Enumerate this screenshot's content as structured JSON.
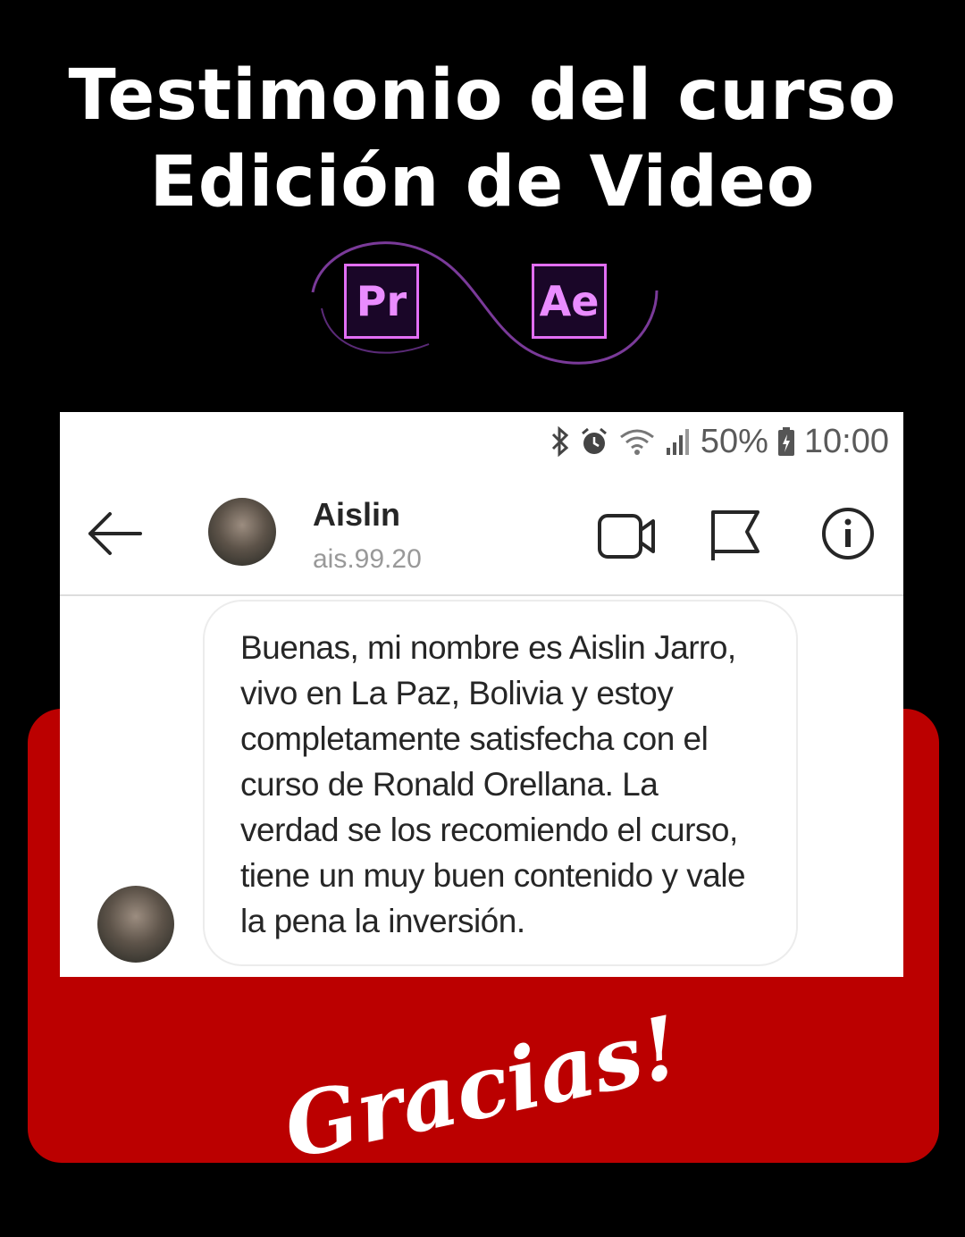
{
  "heading": {
    "line1": "Testimonio del curso",
    "line2": "Edición de Video"
  },
  "logos": {
    "premiere": "Pr",
    "after_effects": "Ae",
    "accent_color": "#e26ef5"
  },
  "status_bar": {
    "icons": [
      "bluetooth-icon",
      "alarm-icon",
      "wifi-icon",
      "signal-icon",
      "battery-icon"
    ],
    "battery_percent": "50%",
    "time": "10:00"
  },
  "chat_header": {
    "username": "Aislin",
    "handle": "ais.99.20",
    "icons": [
      "back-arrow-icon",
      "video-call-icon",
      "flag-icon",
      "info-icon"
    ]
  },
  "message": {
    "text": "Buenas, mi nombre es Aislin Jarro, vivo en La Paz, Bolivia y estoy completamente satisfecha con el curso de Ronald Orellana. La verdad se los recomiendo el curso, tiene un muy buen contenido y vale la pena la inversión."
  },
  "footer": {
    "thanks": "Gracias!",
    "panel_color": "#bb0000"
  }
}
